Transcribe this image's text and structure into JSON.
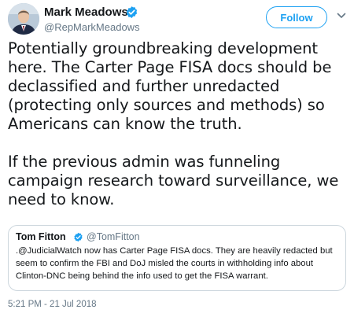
{
  "tweet": {
    "author": {
      "name": "Mark Meadows",
      "handle": "@RepMarkMeadows",
      "avatar_icon": "person-avatar"
    },
    "follow_label": "Follow",
    "text": {
      "paragraph_1": "Potentially groundbreaking development here. The Carter Page FISA docs should be declassified and further unredacted (protecting only sources and methods) so Americans can know the truth.",
      "paragraph_2": "If the previous admin was funneling campaign research toward surveillance, we need to know."
    },
    "quoted": {
      "name": "Tom Fitton",
      "handle": "@TomFitton",
      "text": ".@JudicialWatch now has Carter Page FISA docs. They are heavily redacted but seem to confirm the FBI and DoJ misled the courts in withholding info about Clinton-DNC being behind the info used to get the FISA warrant."
    },
    "timestamp": "5:21 PM - 21 Jul 2018"
  },
  "colors": {
    "accent": "#1da1f2",
    "text": "#14171a",
    "muted": "#657786",
    "border": "#ccd6dd"
  }
}
